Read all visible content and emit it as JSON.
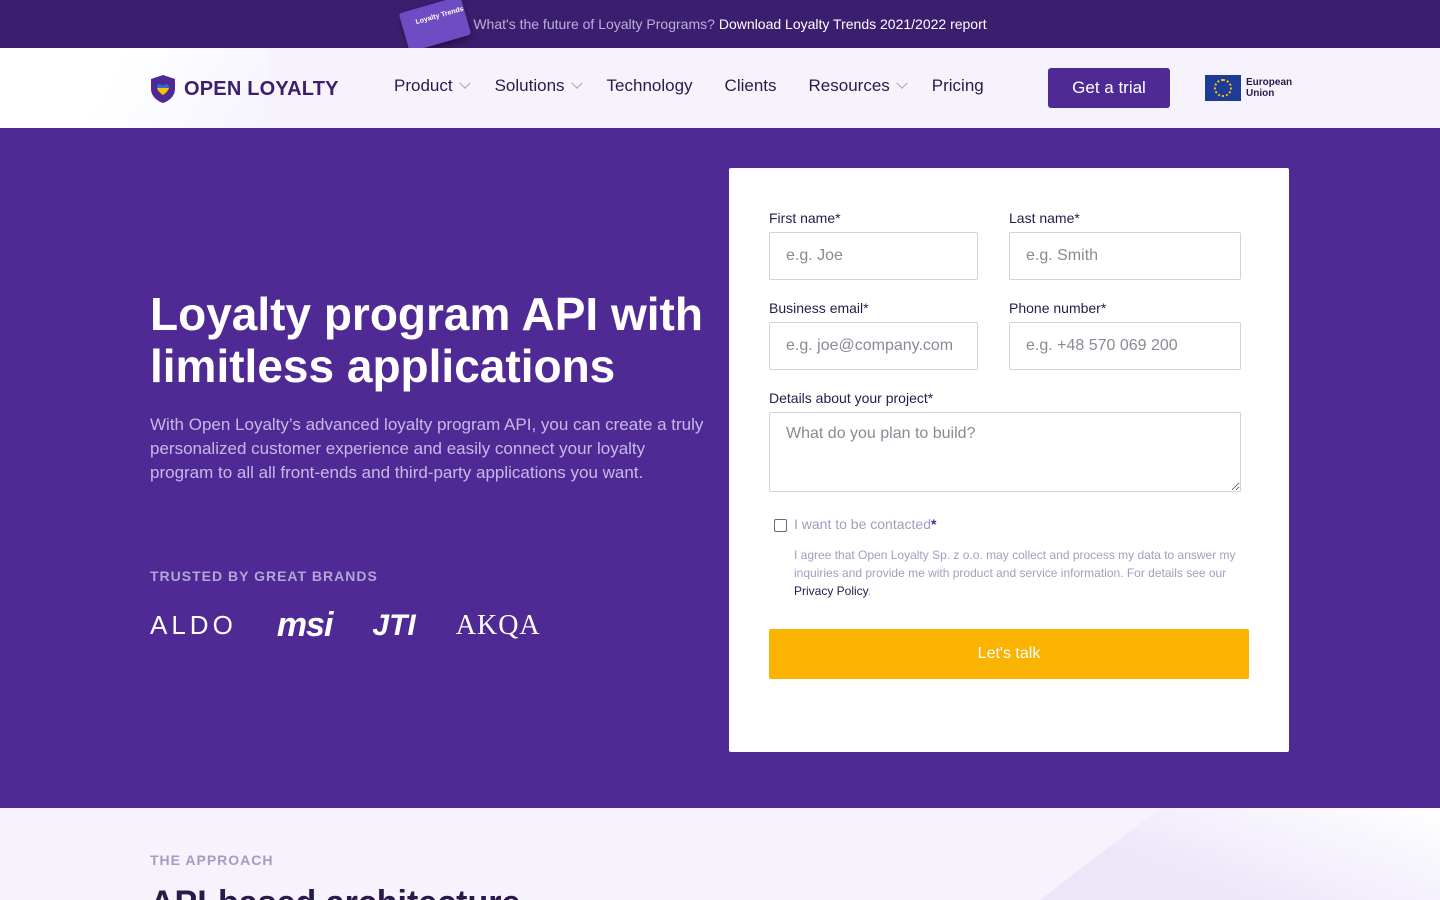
{
  "promo": {
    "book_label": "Loyalty Trends",
    "text": "What's the future of Loyalty Programs?",
    "link": "Download Loyalty Trends 2021/2022 report"
  },
  "header": {
    "logo": "OPEN LOYALTY",
    "nav": [
      {
        "label": "Product",
        "has_dropdown": true
      },
      {
        "label": "Solutions",
        "has_dropdown": true
      },
      {
        "label": "Technology",
        "has_dropdown": false
      },
      {
        "label": "Clients",
        "has_dropdown": false
      },
      {
        "label": "Resources",
        "has_dropdown": true
      },
      {
        "label": "Pricing",
        "has_dropdown": false
      }
    ],
    "cta": "Get a trial",
    "eu_line1": "European",
    "eu_line2": "Union"
  },
  "hero": {
    "title": "Loyalty program API with limitless applications",
    "subtitle": "With Open Loyalty’s advanced loyalty program API, you can create a truly personalized customer experience and easily connect your loyalty program to all all front-ends and third-party applications you want.",
    "trusted_label": "TRUSTED BY GREAT BRANDS",
    "brands": [
      "ALDO",
      "msi",
      "JTI",
      "AKQA"
    ]
  },
  "form": {
    "first_name_label": "First name*",
    "first_name_placeholder": "e.g. Joe",
    "last_name_label": "Last name*",
    "last_name_placeholder": "e.g. Smith",
    "email_label": "Business email*",
    "email_placeholder": "e.g. joe@company.com",
    "phone_label": "Phone number*",
    "phone_placeholder": "e.g. +48 570 069 200",
    "details_label": "Details about your project*",
    "details_placeholder": "What do you plan to build?",
    "consent_label": "I want to be contacted",
    "consent_star": "*",
    "consent_fine": "I agree that Open Loyalty Sp. z o.o. may collect and process my data to answer my inquiries and provide me with product and service information. For details see our",
    "privacy_link": "Privacy Policy",
    "period": ".",
    "submit": "Let's talk"
  },
  "approach": {
    "label": "THE APPROACH",
    "title": "API-based architecture"
  },
  "colors": {
    "brand_purple": "#4f2a94",
    "banner_purple": "#3b1f6e",
    "accent_yellow": "#fab300"
  }
}
